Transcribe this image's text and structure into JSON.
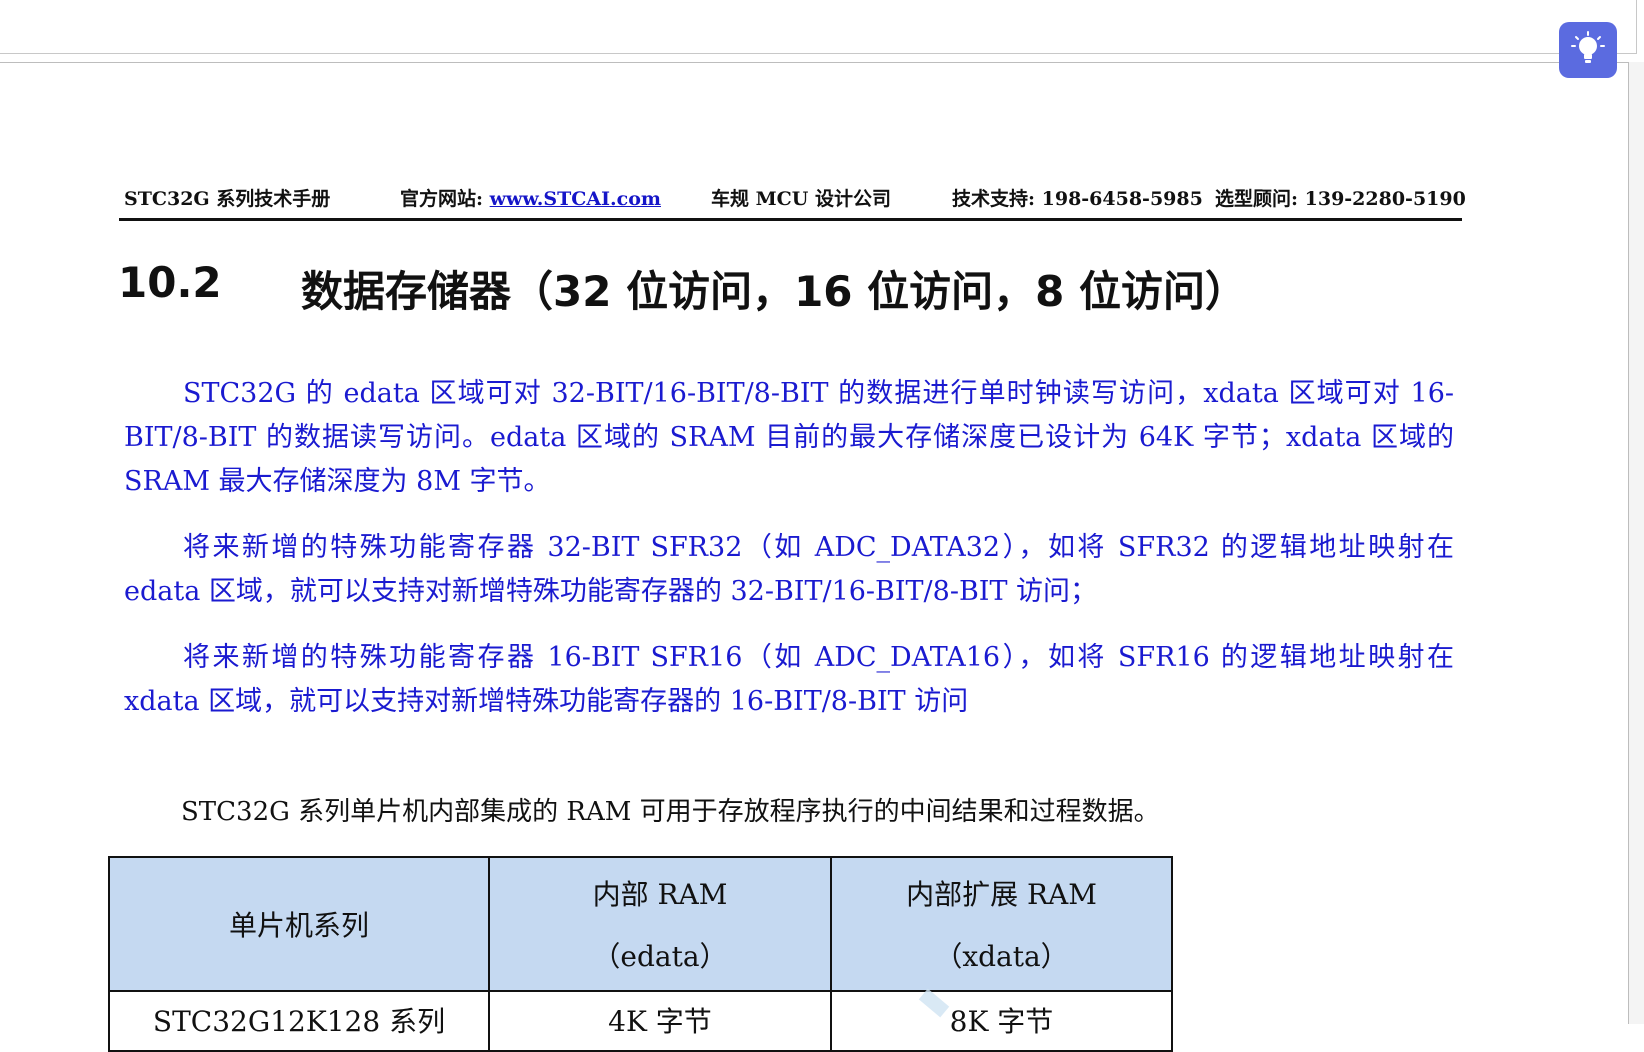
{
  "header": {
    "manual": "STC32G 系列技术手册",
    "website_label": "官方网站: ",
    "website_url": "www.STCAI.com",
    "company": "车规 MCU 设计公司",
    "support": "技术支持: 198-6458-5985",
    "advisor": "选型顾问: 139-2280-5190"
  },
  "section": {
    "number": "10.2",
    "title": "数据存储器（32 位访问，16 位访问，8 位访问）"
  },
  "paragraphs": [
    "STC32G 的 edata 区域可对 32-BIT/16-BIT/8-BIT 的数据进行单时钟读写访问，xdata 区域可对 16-BIT/8-BIT 的数据读写访问。edata 区域的 SRAM 目前的最大存储深度已设计为 64K 字节；xdata 区域的 SRAM 最大存储深度为 8M 字节。",
    "将来新增的特殊功能寄存器 32-BIT SFR32（如 ADC_DATA32），如将 SFR32 的逻辑地址映射在 edata 区域，就可以支持对新增特殊功能寄存器的 32-BIT/16-BIT/8-BIT 访问；",
    "将来新增的特殊功能寄存器 16-BIT SFR16（如 ADC_DATA16），如将 SFR16 的逻辑地址映射在 xdata 区域，就可以支持对新增特殊功能寄存器的 16-BIT/8-BIT  访问"
  ],
  "intro": "STC32G 系列单片机内部集成的 RAM 可用于存放程序执行的中间结果和过程数据。",
  "table": {
    "headers": [
      {
        "line1": "单片机系列",
        "line2": ""
      },
      {
        "line1": "内部 RAM",
        "line2": "（edata）"
      },
      {
        "line1": "内部扩展 RAM",
        "line2": "（xdata）"
      }
    ],
    "rows": [
      [
        "STC32G12K128 系列",
        "4K 字节",
        "8K 字节"
      ]
    ]
  },
  "colors": {
    "body_text_blue": "#1a1ad0",
    "table_header_bg": "#c5d9f1",
    "hint_button": "#5b6be0"
  },
  "icons": {
    "hint": "lightbulb-icon"
  }
}
